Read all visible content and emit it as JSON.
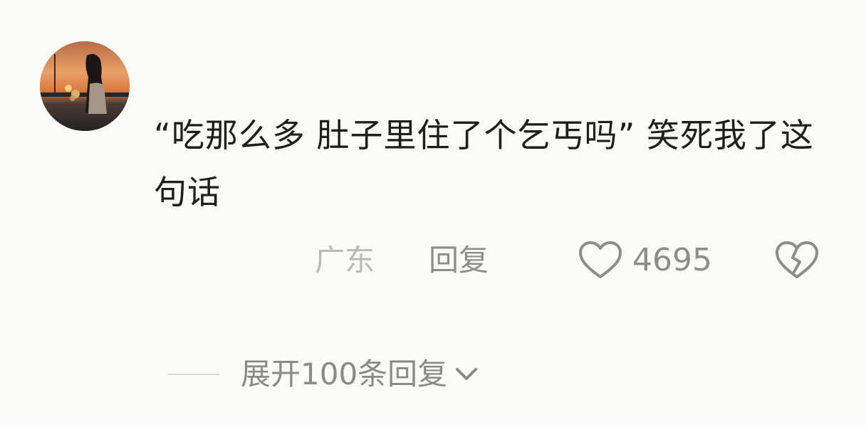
{
  "comment": {
    "text": "“吃那么多 肚子里住了个乞丐吗” 笑死我了这句话",
    "location": "广东",
    "reply_label": "回复",
    "like_count": "4695",
    "icons": {
      "like": "heart-outline-icon",
      "dislike": "broken-heart-icon",
      "expand": "chevron-down-icon"
    }
  },
  "replies": {
    "expand_label": "展开100条回复"
  },
  "colors": {
    "text": "#1e1e1e",
    "muted": "#8d8d8d",
    "location": "#b9b9b9",
    "background": "#fafaf8"
  }
}
